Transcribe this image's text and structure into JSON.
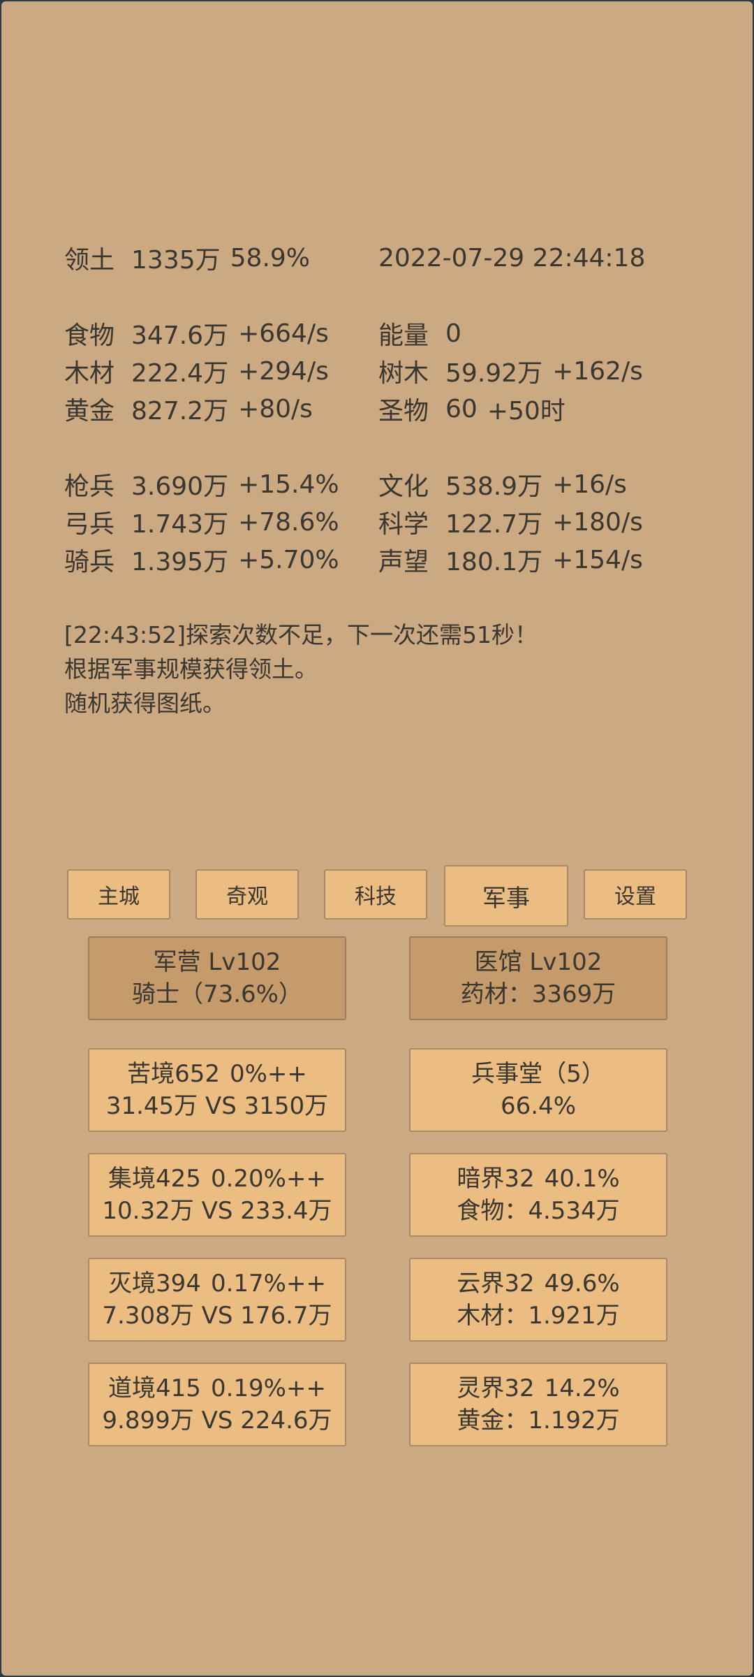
{
  "territory": {
    "label": "领土",
    "value": "1335万",
    "percent": "58.9%",
    "datetime": "2022-07-29 22:44:18"
  },
  "resources": [
    {
      "left": {
        "label": "食物",
        "value": "347.6万",
        "rate": "+664/s"
      },
      "right": {
        "label": "能量",
        "value": "0",
        "rate": ""
      }
    },
    {
      "left": {
        "label": "木材",
        "value": "222.4万",
        "rate": "+294/s"
      },
      "right": {
        "label": "树木",
        "value": "59.92万",
        "rate": "+162/s"
      }
    },
    {
      "left": {
        "label": "黄金",
        "value": "827.2万",
        "rate": "+80/s"
      },
      "right": {
        "label": "圣物",
        "value": "60",
        "rate": "+50时"
      }
    }
  ],
  "military": [
    {
      "left": {
        "label": "枪兵",
        "value": "3.690万",
        "rate": "+15.4%"
      },
      "right": {
        "label": "文化",
        "value": "538.9万",
        "rate": "+16/s"
      }
    },
    {
      "left": {
        "label": "弓兵",
        "value": "1.743万",
        "rate": "+78.6%"
      },
      "right": {
        "label": "科学",
        "value": "122.7万",
        "rate": "+180/s"
      }
    },
    {
      "left": {
        "label": "骑兵",
        "value": "1.395万",
        "rate": "+5.70%"
      },
      "right": {
        "label": "声望",
        "value": "180.1万",
        "rate": "+154/s"
      }
    }
  ],
  "log": [
    "[22:43:52]探索次数不足，下一次还需51秒！",
    "根据军事规模获得领土。",
    "随机获得图纸。"
  ],
  "tabs": [
    "主城",
    "奇观",
    "科技",
    "军事",
    "设置"
  ],
  "active_tab": "军事",
  "cards": [
    {
      "line1a": "军营 Lv102",
      "line1b": "",
      "line2": "骑士（73.6%）"
    },
    {
      "line1a": "医馆 Lv102",
      "line1b": "",
      "line2": "药材：3369万"
    },
    {
      "line1a": "苦境652",
      "line1b": "0%++",
      "line2": "31.45万 VS 3150万"
    },
    {
      "line1a": "兵事堂（5）",
      "line1b": "",
      "line2": "66.4%"
    },
    {
      "line1a": "集境425",
      "line1b": "0.20%++",
      "line2": "10.32万 VS 233.4万"
    },
    {
      "line1a": "暗界32",
      "line1b": "40.1%",
      "line2": "食物：4.534万"
    },
    {
      "line1a": "灭境394",
      "line1b": "0.17%++",
      "line2": "7.308万 VS 176.7万"
    },
    {
      "line1a": "云界32",
      "line1b": "49.6%",
      "line2": "木材：1.921万"
    },
    {
      "line1a": "道境415",
      "line1b": "0.19%++",
      "line2": "9.899万 VS 224.6万"
    },
    {
      "line1a": "灵界32",
      "line1b": "14.2%",
      "line2": "黄金：1.192万"
    }
  ],
  "colors": {
    "background": "#cba983",
    "button": "#ebbd82",
    "button_dark": "#c69b6b",
    "text": "#3a3630"
  }
}
